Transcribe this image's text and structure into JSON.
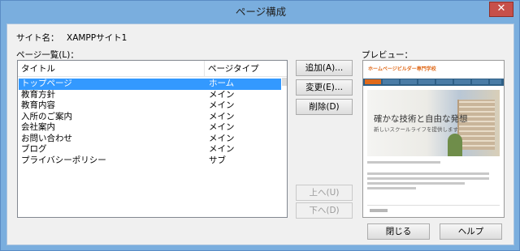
{
  "window": {
    "title": "ページ構成",
    "close_glyph": "✕"
  },
  "site": {
    "label": "サイト名：",
    "name": "XAMPPサイト1"
  },
  "list": {
    "label": "ページ一覧(L)：",
    "headers": {
      "title": "タイトル",
      "type": "ページタイプ"
    },
    "rows": [
      {
        "title": "トップページ",
        "type": "ホーム",
        "selected": true
      },
      {
        "title": "教育方針",
        "type": "メイン"
      },
      {
        "title": "教育内容",
        "type": "メイン"
      },
      {
        "title": "入所のご案内",
        "type": "メイン"
      },
      {
        "title": "会社案内",
        "type": "メイン"
      },
      {
        "title": "お問い合わせ",
        "type": "メイン"
      },
      {
        "title": "ブログ",
        "type": "メイン"
      },
      {
        "title": "プライバシーポリシー",
        "type": "サブ"
      }
    ]
  },
  "buttons": {
    "add": "追加(A)...",
    "change": "変更(E)...",
    "delete": "削除(D)",
    "up": "上へ(U)",
    "down": "下へ(D)",
    "close": "閉じる",
    "help": "ヘルプ"
  },
  "preview": {
    "label": "プレビュー：",
    "logo_text": "ホームページビルダー専門学校",
    "headline": "確かな技術と自由な発想",
    "subheadline": "新しいスクールライフを提供します"
  }
}
